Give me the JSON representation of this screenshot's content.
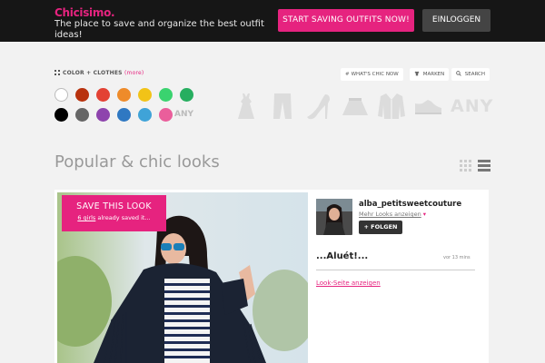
{
  "header": {
    "logo_prefix": "Chic",
    "logo_suffix": "isimo.",
    "tagline": "The place to save and organize the best outfit ideas!",
    "cta_label": "START SAVING OUTFITS NOW!",
    "login_label": "EINLOGGEN"
  },
  "filters": {
    "label": "COLOR + CLOTHES",
    "more_label": "(more)",
    "colors": [
      "#ffffff",
      "#b8320e",
      "#e34234",
      "#ee8b2a",
      "#f2c317",
      "#3ad36f",
      "#27ae60",
      "#000000",
      "#666666",
      "#8e44ad",
      "#2f78c2",
      "#3fa3d8",
      "#ea5e9b"
    ],
    "any_color_label": "ANY",
    "chips": [
      {
        "icon": "#",
        "label": "WHAT'S CHIC NOW"
      },
      {
        "icon": "tshirt-icon",
        "label": "MARKEN"
      },
      {
        "icon": "search-icon",
        "label": "SEARCH"
      }
    ],
    "clothes": [
      "dress-icon",
      "pants-icon",
      "heels-icon",
      "skirt-icon",
      "jacket-icon",
      "sneaker-icon"
    ],
    "any_clothes_label": "ANY"
  },
  "section": {
    "title": "Popular & chic looks"
  },
  "look": {
    "save_label": "SAVE THIS LOOK",
    "saved_count": "6 girls",
    "saved_suffix": " already saved it...",
    "username": "alba_petitsweetcouture",
    "more_looks": "Mehr Looks anzeigen",
    "follow_label": "+ FOLGEN",
    "title": "...Aluét!...",
    "time": "vor 13 mins",
    "link_label": "Look-Seite anzeigen"
  },
  "colors": {
    "accent": "#e6237f",
    "topbar": "#161616",
    "background": "#f2f2f2"
  }
}
